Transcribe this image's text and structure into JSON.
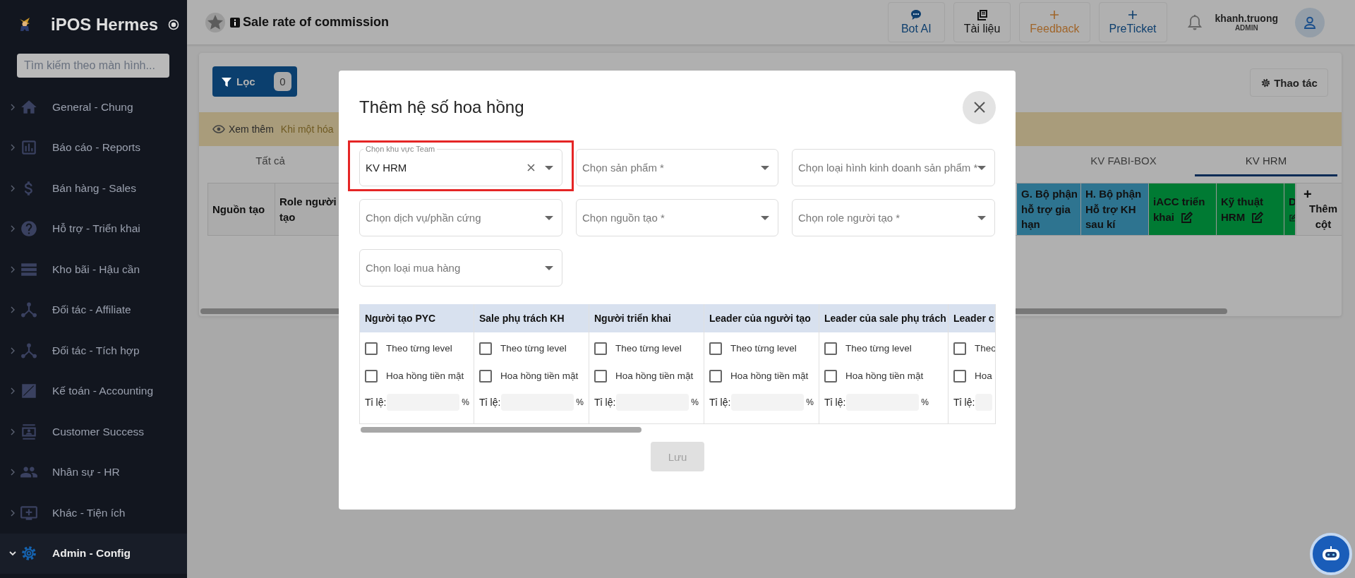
{
  "sidebar": {
    "brand": "iPOS Hermes",
    "search": {
      "placeholder": "Tìm kiếm theo màn hình..."
    },
    "items": [
      {
        "label": "General - Chung",
        "kind": "home",
        "selected": false,
        "expanded": false
      },
      {
        "label": "Báo cáo - Reports",
        "kind": "chart",
        "selected": false,
        "expanded": false
      },
      {
        "label": "Bán hàng - Sales",
        "kind": "dollar",
        "selected": false,
        "expanded": false
      },
      {
        "label": "Hỗ trợ - Triển khai",
        "kind": "help",
        "selected": false,
        "expanded": false
      },
      {
        "label": "Kho bãi - Hậu cần",
        "kind": "storage",
        "selected": false,
        "expanded": false
      },
      {
        "label": "Đối tác - Affiliate",
        "kind": "hub",
        "selected": false,
        "expanded": false
      },
      {
        "label": "Đối tác - Tích hợp",
        "kind": "hub",
        "selected": false,
        "expanded": false
      },
      {
        "label": "Kế toán - Accounting",
        "kind": "accounting",
        "selected": false,
        "expanded": false
      },
      {
        "label": "Customer Success",
        "kind": "card",
        "selected": false,
        "expanded": false
      },
      {
        "label": "Nhân sự - HR",
        "kind": "people",
        "selected": false,
        "expanded": false
      },
      {
        "label": "Khác - Tiện ích",
        "kind": "monitor",
        "selected": false,
        "expanded": false
      },
      {
        "label": "Admin - Config",
        "kind": "gear",
        "selected": true,
        "expanded": true
      }
    ]
  },
  "topbar": {
    "title": "Sale rate of commission",
    "buttons": [
      {
        "label": "Bot AI",
        "kind": "chat",
        "color": "#0e3f6e"
      },
      {
        "label": "Tài liệu",
        "kind": "docs",
        "color": "#111111"
      },
      {
        "label": "Feedback",
        "kind": "plus",
        "color": "#a0652a"
      },
      {
        "label": "PreTicket",
        "kind": "plus",
        "color": "#0e3f6e"
      }
    ],
    "user": {
      "name": "khanh.truong",
      "role": "ADMIN"
    }
  },
  "content": {
    "filter_button": {
      "label": "Lọc",
      "count": "0"
    },
    "actions_button": {
      "label": "Thao tác"
    },
    "notice": {
      "link": "Xem thêm",
      "text": "Khi một hóa"
    },
    "tabs": [
      {
        "label": "Tất cả",
        "selected": false
      },
      {
        "label": "KV FABI-BOX",
        "selected": false
      },
      {
        "label": "KV HRM",
        "selected": true
      }
    ],
    "table": {
      "columns": [
        {
          "label": "Nguồn tạo",
          "color": "#ababab",
          "editable": false
        },
        {
          "label": "Role người tạo",
          "color": "#ababab",
          "editable": false
        },
        {
          "label": "G. Bộ phận hỗ trợ gia hạn",
          "color": "#2e7490",
          "editable": false
        },
        {
          "label": "H. Bộ phận Hỗ trợ KH sau kí",
          "color": "#2e7490",
          "editable": false
        },
        {
          "label": "iACC triển khai",
          "color": "#007a33",
          "editable": true
        },
        {
          "label": "Kỹ thuật HRM",
          "color": "#007a33",
          "editable": true
        },
        {
          "label": "D",
          "color": "#007a33",
          "editable": true
        }
      ],
      "add_column": {
        "icon": "+",
        "label": "Thêm cột"
      }
    }
  },
  "modal": {
    "title": "Thêm hệ số hoa hồng",
    "fields": [
      {
        "label": "Chọn khu vực Team",
        "value": "KV HRM",
        "clearable": true,
        "highlighted": true
      },
      {
        "placeholder": "Chọn sản phẩm *",
        "clearable": false,
        "highlighted": false
      },
      {
        "placeholder": "Chọn loại hình kinh doanh sản phẩm *",
        "clearable": false,
        "highlighted": false
      },
      {
        "placeholder": "Chọn dịch vụ/phần cứng",
        "clearable": false,
        "highlighted": false
      },
      {
        "placeholder": "Chọn nguồn tạo *",
        "clearable": false,
        "highlighted": false
      },
      {
        "placeholder": "Chọn role người tạo *",
        "clearable": false,
        "highlighted": false
      },
      {
        "placeholder": "Chọn loại mua hàng",
        "clearable": false,
        "highlighted": false
      }
    ],
    "roles": [
      {
        "title": "Người tạo PYC",
        "options": [
          {
            "label": "Theo từng level",
            "checked": false
          },
          {
            "label": "Hoa hồng tiền mặt",
            "checked": false
          }
        ],
        "rate_label": "Tỉ lệ:",
        "unit": "%"
      },
      {
        "title": "Sale phụ trách KH",
        "options": [
          {
            "label": "Theo từng level",
            "checked": false
          },
          {
            "label": "Hoa hồng tiền mặt",
            "checked": false
          }
        ],
        "rate_label": "Tỉ lệ:",
        "unit": "%"
      },
      {
        "title": "Người triển khai",
        "options": [
          {
            "label": "Theo từng level",
            "checked": false
          },
          {
            "label": "Hoa hồng tiền mặt",
            "checked": false
          }
        ],
        "rate_label": "Tỉ lệ:",
        "unit": "%"
      },
      {
        "title": "Leader của người tạo",
        "options": [
          {
            "label": "Theo từng level",
            "checked": false
          },
          {
            "label": "Hoa hồng tiền mặt",
            "checked": false
          }
        ],
        "rate_label": "Tỉ lệ:",
        "unit": "%"
      },
      {
        "title": "Leader của sale phụ trách",
        "options": [
          {
            "label": "Theo từng level",
            "checked": false
          },
          {
            "label": "Hoa hồng tiền mặt",
            "checked": false
          }
        ],
        "rate_label": "Tỉ lệ:",
        "unit": "%"
      },
      {
        "title": "Leader c",
        "options": [
          {
            "label": "Theo",
            "checked": false
          },
          {
            "label": "Hoa",
            "checked": false
          }
        ],
        "rate_label": "Tỉ lệ:"
      }
    ],
    "save_button": {
      "label": "Lưu",
      "disabled": true
    }
  }
}
